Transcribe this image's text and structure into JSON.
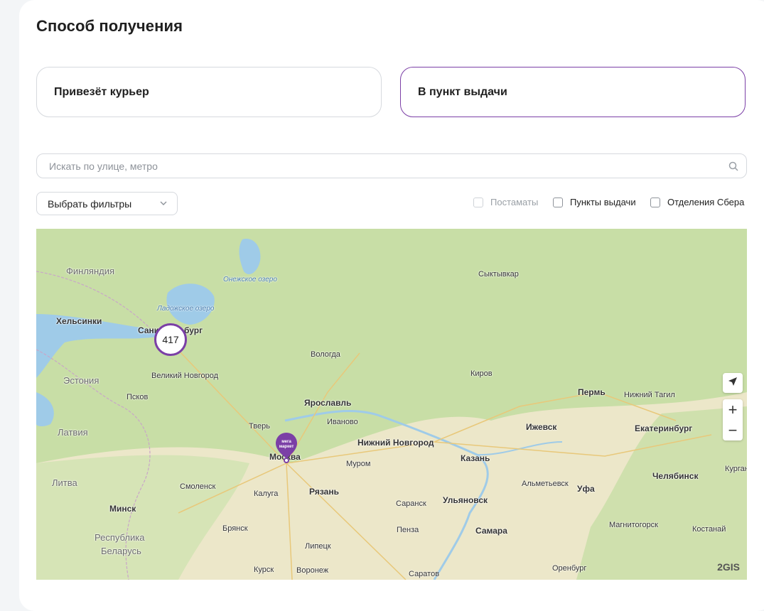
{
  "title": "Способ получения",
  "delivery": {
    "courier_label": "Привезёт курьер",
    "pickup_label": "В пункт выдачи",
    "selected": "pickup"
  },
  "search": {
    "placeholder": "Искать по улице, метро",
    "value": ""
  },
  "filters": {
    "dropdown_label": "Выбрать фильтры",
    "checkboxes": [
      {
        "label": "Постаматы",
        "checked": false,
        "disabled": true
      },
      {
        "label": "Пункты выдачи",
        "checked": false,
        "disabled": false
      },
      {
        "label": "Отделения Сбера",
        "checked": false,
        "disabled": false
      }
    ]
  },
  "map": {
    "cluster_count": "417",
    "marker_label": "мега маркет",
    "provider": "2GIS",
    "labels": {
      "finland": "Финляндия",
      "helsinki": "Хельсинки",
      "estonia": "Эстония",
      "latvia": "Латвия",
      "lithuania": "Литва",
      "minsk": "Минск",
      "belarus_1": "Республика",
      "belarus_2": "Беларусь",
      "spb_left": "Санкт",
      "spb_right": "бург",
      "onega": "Онежское озеро",
      "ladoga": "Ладожское озеро",
      "novgorod": "Великий Новгород",
      "pskov": "Псков",
      "vologda": "Вологда",
      "syktyvkar": "Сыктывкар",
      "kirov": "Киров",
      "perm": "Пермь",
      "ntagil": "Нижний Тагил",
      "yaroslavl": "Ярославль",
      "ivanovo": "Иваново",
      "tver": "Тверь",
      "moscow": "Москва",
      "nnovgorod": "Нижний Новгород",
      "kazan": "Казань",
      "izhevsk": "Ижевск",
      "ekb": "Екатеринбург",
      "chelyabinsk": "Челябинск",
      "kurgan": "Курган",
      "murom": "Муром",
      "smolensk": "Смоленск",
      "kaluga": "Калуга",
      "ryazan": "Рязань",
      "almetyevsk": "Альметьевск",
      "ufa": "Уфа",
      "saransk": "Саранск",
      "ulyanovsk": "Ульяновск",
      "bryansk": "Брянск",
      "penza": "Пенза",
      "samara": "Самара",
      "magnitogorsk": "Магнитогорск",
      "kostanay": "Костанай",
      "lipetsk": "Липецк",
      "kursk": "Курск",
      "voronezh": "Воронеж",
      "saratov": "Саратов",
      "orenburg": "Оренбург"
    }
  },
  "colors": {
    "accent": "#7b3fa6",
    "water": "#9fcbe8",
    "forest": "#c8dea6",
    "steppe": "#ece7c9"
  }
}
